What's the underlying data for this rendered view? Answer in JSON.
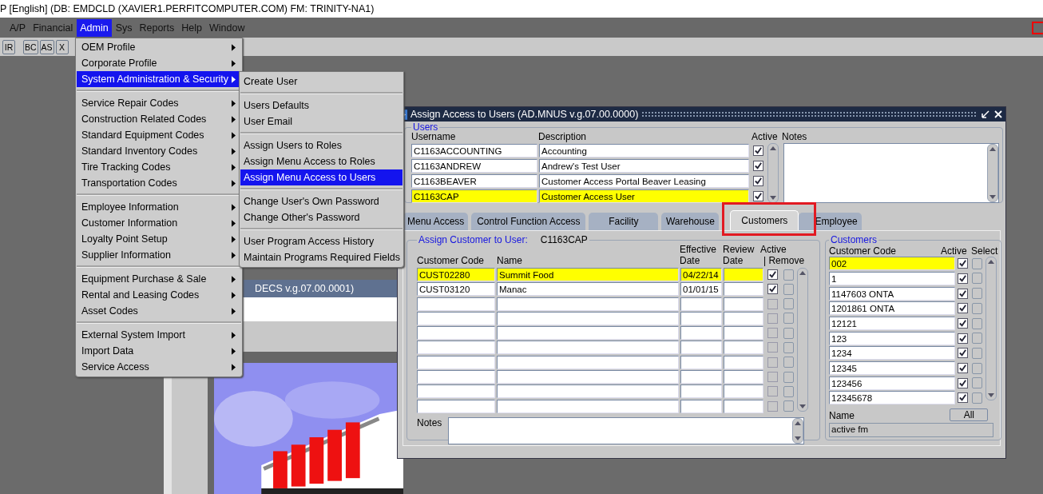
{
  "title_bar": {
    "title": "P [English] (DB: EMDCLD (XAVIER1.PERFITCOMPUTER.COM) FM: TRINITY-NA1)"
  },
  "menu_bar": [
    {
      "label": "A/P",
      "selected": false
    },
    {
      "label": "Financial",
      "selected": false
    },
    {
      "label": "Admin",
      "selected": true
    },
    {
      "label": "Sys",
      "selected": false
    },
    {
      "label": "Reports",
      "selected": false
    },
    {
      "label": "Help",
      "selected": false
    },
    {
      "label": "Window",
      "selected": false
    }
  ],
  "toolbar": [
    "IR",
    "BC",
    "AS",
    "X"
  ],
  "admin_menu": {
    "groups": [
      [
        {
          "label": "OEM Profile",
          "selected": false
        },
        {
          "label": "Corporate Profile",
          "selected": false
        },
        {
          "label": "System Administration & Security",
          "selected": true
        }
      ],
      [
        {
          "label": "Service Repair Codes",
          "selected": false
        },
        {
          "label": "Construction Related Codes",
          "selected": false
        },
        {
          "label": "Standard Equipment Codes",
          "selected": false
        },
        {
          "label": "Standard Inventory Codes",
          "selected": false
        },
        {
          "label": "Tire Tracking Codes",
          "selected": false
        },
        {
          "label": "Transportation Codes",
          "selected": false
        }
      ],
      [
        {
          "label": "Employee Information",
          "selected": false
        },
        {
          "label": "Customer Information",
          "selected": false
        },
        {
          "label": "Loyalty Point Setup",
          "selected": false
        },
        {
          "label": "Supplier Information",
          "selected": false
        }
      ],
      [
        {
          "label": "Equipment Purchase & Sale",
          "selected": false
        },
        {
          "label": "Rental and Leasing Codes",
          "selected": false
        },
        {
          "label": "Asset Codes",
          "selected": false
        }
      ],
      [
        {
          "label": "External System Import",
          "selected": false
        },
        {
          "label": "Import Data",
          "selected": false
        },
        {
          "label": "Service Access",
          "selected": false
        }
      ]
    ]
  },
  "submenu": {
    "groups": [
      [
        {
          "label": "Create User",
          "selected": false
        }
      ],
      [
        {
          "label": "Users Defaults",
          "selected": false
        },
        {
          "label": "User Email",
          "selected": false
        }
      ],
      [
        {
          "label": "Assign Users to Roles",
          "selected": false
        },
        {
          "label": "Assign Menu Access to Roles",
          "selected": false
        },
        {
          "label": "Assign Menu Access to Users",
          "selected": true
        }
      ],
      [
        {
          "label": "Change User's Own Password",
          "selected": false
        },
        {
          "label": "Change Other's Password",
          "selected": false
        }
      ],
      [
        {
          "label": "User Program Access History",
          "selected": false
        },
        {
          "label": "Maintain Programs Required Fields",
          "selected": false
        }
      ]
    ]
  },
  "background_window": {
    "title": "DECS v.g.07.00.0001)"
  },
  "dialog": {
    "title": "Assign Access to Users (AD.MNUS v.g.07.00.0000)",
    "users": {
      "label": "Users",
      "columns": [
        "Username",
        "Description",
        "Active",
        "Notes"
      ],
      "rows": [
        {
          "username": "C1163ACCOUNTING",
          "description": "Accounting",
          "active": true,
          "selected": false
        },
        {
          "username": "C1163ANDREW",
          "description": "Andrew's Test User",
          "active": true,
          "selected": false
        },
        {
          "username": "C1163BEAVER",
          "description": "Customer Access Portal Beaver Leasing",
          "active": true,
          "selected": false
        },
        {
          "username": "C1163CAP",
          "description": "Customer Access User",
          "active": true,
          "selected": true
        }
      ]
    },
    "tabs": [
      {
        "label": "Menu Access",
        "selected": false,
        "highlighted": false
      },
      {
        "label": "Control Function Access",
        "selected": false,
        "highlighted": false
      },
      {
        "label": "Facility",
        "selected": false,
        "highlighted": false
      },
      {
        "label": "Warehouse",
        "selected": false,
        "highlighted": false
      },
      {
        "label": "Customers",
        "selected": true,
        "highlighted": true
      },
      {
        "label": "Employee",
        "selected": false,
        "highlighted": false
      }
    ],
    "assign": {
      "label": "Assign Customer to User:",
      "user": "C1163CAP",
      "columns": [
        "Customer Code",
        "Name",
        "Effective",
        "Date",
        "Review",
        "Date",
        "Active",
        "| Remove"
      ],
      "rows": [
        {
          "code": "CUST02280",
          "name": "Summit Food",
          "effective": "04/22/14",
          "active": true,
          "remove": false,
          "selected": true
        },
        {
          "code": "CUST03120",
          "name": "Manac",
          "effective": "01/01/15",
          "active": true,
          "remove": false,
          "selected": false
        },
        {
          "active": false,
          "remove": false,
          "selected": false
        },
        {
          "active": false,
          "remove": false,
          "selected": false
        },
        {
          "active": false,
          "remove": false,
          "selected": false
        },
        {
          "active": false,
          "remove": false,
          "selected": false
        },
        {
          "active": false,
          "remove": false,
          "selected": false
        },
        {
          "active": false,
          "remove": false,
          "selected": false
        },
        {
          "active": false,
          "remove": false,
          "selected": false
        },
        {
          "active": false,
          "remove": false,
          "selected": false
        }
      ],
      "notes_label": "Notes"
    },
    "customers": {
      "label": "Customers",
      "columns": [
        "Customer Code",
        "Active",
        "Select"
      ],
      "rows": [
        {
          "code": "002",
          "active": true,
          "select": false,
          "selected": true
        },
        {
          "code": "1",
          "active": true,
          "select": false,
          "selected": false
        },
        {
          "code": "1147603 ONTA",
          "active": true,
          "select": false,
          "selected": false
        },
        {
          "code": "1201861 ONTA",
          "active": true,
          "select": false,
          "selected": false
        },
        {
          "code": "12121",
          "active": true,
          "select": false,
          "selected": false
        },
        {
          "code": "123",
          "active": true,
          "select": false,
          "selected": false
        },
        {
          "code": "1234",
          "active": true,
          "select": false,
          "selected": false
        },
        {
          "code": "12345",
          "active": true,
          "select": false,
          "selected": false
        },
        {
          "code": "123456",
          "active": true,
          "select": false,
          "selected": false
        },
        {
          "code": "12345678",
          "active": true,
          "select": false,
          "selected": false
        }
      ],
      "all_button": "All",
      "name_label": "Name",
      "name_value": "active fm"
    }
  }
}
